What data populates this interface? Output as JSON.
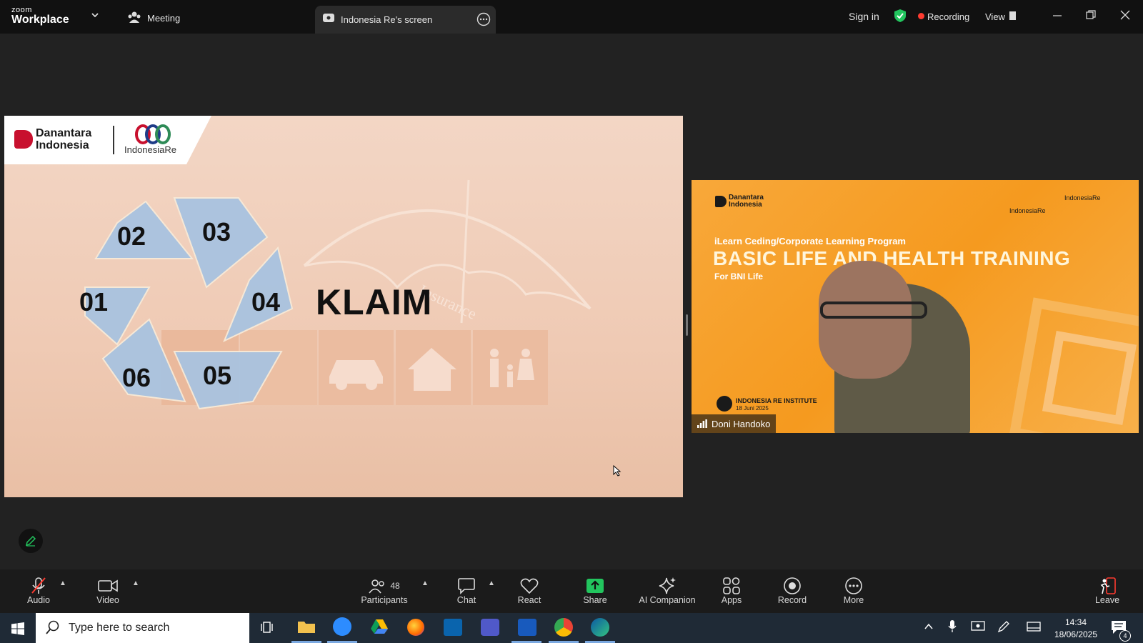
{
  "titlebar": {
    "brand_small": "zoom",
    "brand_big": "Workplace",
    "meeting_label": "Meeting",
    "tab_title": "Indonesia Re's screen",
    "sign_in": "Sign in",
    "recording": "Recording",
    "view": "View"
  },
  "slide": {
    "logo1_line1": "Danantara",
    "logo1_line2": "Indonesia",
    "logo2": "IndonesiaRe",
    "heading": "KLAIM",
    "watermark": "Insurance",
    "segments": [
      "01",
      "02",
      "03",
      "04",
      "05",
      "06"
    ]
  },
  "video": {
    "logo": "Danantara Indonesia",
    "logo_right1": "IndonesiaRe",
    "logo_right2": "IndonesiaRe",
    "program": "iLearn Ceding/Corporate Learning Program",
    "title": "BASIC LIFE AND HEALTH TRAINING",
    "subtitle": "For BNI Life",
    "institute": "INDONESIA RE INSTITUTE",
    "date": "18 Juni 2025",
    "participant_name": "Doni Handoko"
  },
  "toolbar": {
    "audio": "Audio",
    "video": "Video",
    "participants": "Participants",
    "participants_count": "48",
    "chat": "Chat",
    "react": "React",
    "share": "Share",
    "ai_companion": "AI Companion",
    "apps": "Apps",
    "record": "Record",
    "more": "More",
    "leave": "Leave"
  },
  "taskbar": {
    "search_placeholder": "Type here to search",
    "time": "14:34",
    "date": "18/06/2025",
    "notification_count": "4"
  },
  "colors": {
    "accent_green": "#22c55e",
    "recording_red": "#ff3b30",
    "video_orange": "#f59a1f",
    "slide_bg": "#f0cdb8"
  }
}
